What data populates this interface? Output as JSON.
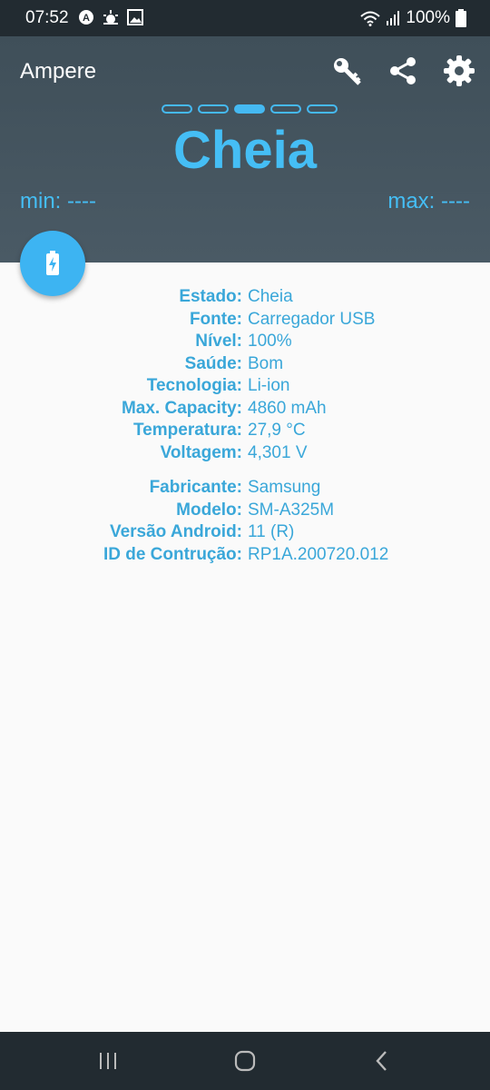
{
  "status_bar": {
    "time": "07:52",
    "battery": "100%"
  },
  "app": {
    "title": "Ampere"
  },
  "header": {
    "status": "Cheia",
    "min": "min: ----",
    "max": "max: ----"
  },
  "info_rows": [
    {
      "key": "Estado:",
      "value": "Cheia"
    },
    {
      "key": "Fonte:",
      "value": "Carregador USB"
    },
    {
      "key": "Nível:",
      "value": "100%"
    },
    {
      "key": "Saúde:",
      "value": "Bom"
    },
    {
      "key": "Tecnologia:",
      "value": "Li-ion"
    },
    {
      "key": "Max. Capacity:",
      "value": "4860 mAh"
    },
    {
      "key": "Temperatura:",
      "value": "27,9 °C"
    },
    {
      "key": "Voltagem:",
      "value": "4,301 V"
    }
  ],
  "device_rows": [
    {
      "key": "Fabricante:",
      "value": "Samsung"
    },
    {
      "key": "Modelo:",
      "value": "SM-A325M"
    },
    {
      "key": "Versão Android:",
      "value": "11 (R)"
    },
    {
      "key": "ID de Contrução:",
      "value": "RP1A.200720.012"
    }
  ],
  "colors": {
    "accent": "#45bef5",
    "header_bg": "#45555f"
  }
}
